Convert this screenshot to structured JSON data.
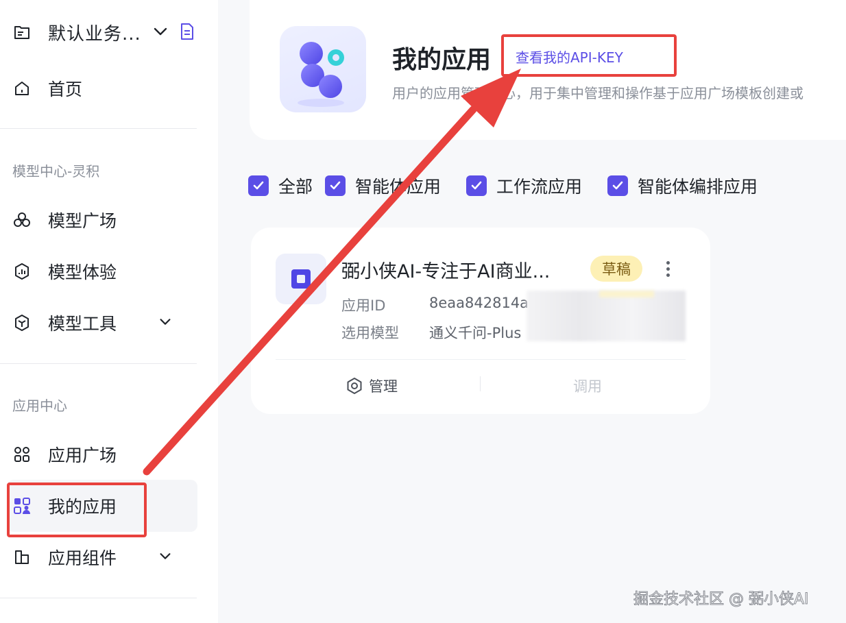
{
  "sidebar": {
    "workspace": {
      "name": "默认业务...",
      "icon": "folder-icon",
      "chevron_icon": "chevron-down-icon",
      "doc_icon": "document-icon"
    },
    "home": {
      "label": "首页",
      "icon": "home-icon"
    },
    "group1": {
      "title": "模型中心-灵积"
    },
    "model_items": [
      {
        "label": "模型广场",
        "icon": "cluster-icon"
      },
      {
        "label": "模型体验",
        "icon": "hexagon-chart-icon"
      },
      {
        "label": "模型工具",
        "icon": "cube-icon",
        "has_chevron": true
      }
    ],
    "group2": {
      "title": "应用中心"
    },
    "app_items": [
      {
        "label": "应用广场",
        "icon": "grid-icon"
      },
      {
        "label": "我的应用",
        "icon": "my-apps-icon",
        "active": true
      },
      {
        "label": "应用组件",
        "icon": "component-icon",
        "has_chevron": true
      }
    ]
  },
  "header": {
    "title": "我的应用",
    "api_key_link": "查看我的API-KEY",
    "description": "用户的应用管理中心，用于集中管理和操作基于应用广场模板创建或"
  },
  "filters": [
    {
      "label": "全部",
      "checked": true
    },
    {
      "label": "智能体应用",
      "checked": true
    },
    {
      "label": "工作流应用",
      "checked": true
    },
    {
      "label": "智能体编排应用",
      "checked": true
    }
  ],
  "app_card": {
    "title": "弼小侠AI-专注于AI商业...",
    "status_badge": "草稿",
    "meta": [
      {
        "label": "应用ID",
        "value": "8eaa842814a"
      },
      {
        "label": "选用模型",
        "value": "通义千问-Plus"
      }
    ],
    "actions": {
      "manage": "管理",
      "call": "调用"
    }
  },
  "watermark": "掘金技术社区 @ 弼小侠AI",
  "colors": {
    "accent": "#5b4ee6",
    "annotation": "#e8413d",
    "badge_bg": "#fdf0b5"
  }
}
